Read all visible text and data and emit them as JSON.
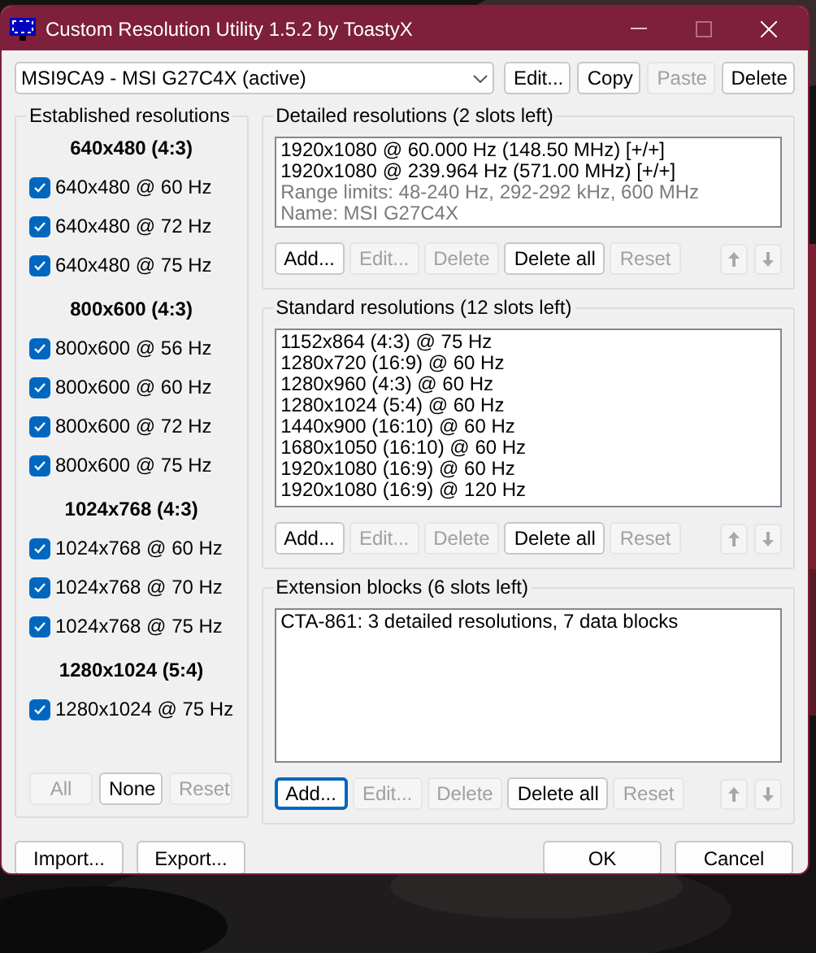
{
  "window": {
    "title": "Custom Resolution Utility 1.5.2 by ToastyX"
  },
  "device_select": {
    "value": "MSI9CA9 - MSI G27C4X (active)"
  },
  "top_buttons": [
    {
      "label": "Edit...",
      "disabled": false
    },
    {
      "label": "Copy",
      "disabled": false
    },
    {
      "label": "Paste",
      "disabled": true
    },
    {
      "label": "Delete",
      "disabled": false
    }
  ],
  "established": {
    "title": "Established resolutions",
    "groups": [
      {
        "heading": "640x480 (4:3)",
        "items": [
          {
            "label": "640x480 @ 60 Hz",
            "checked": true
          },
          {
            "label": "640x480 @ 72 Hz",
            "checked": true
          },
          {
            "label": "640x480 @ 75 Hz",
            "checked": true
          }
        ]
      },
      {
        "heading": "800x600 (4:3)",
        "items": [
          {
            "label": "800x600 @ 56 Hz",
            "checked": true
          },
          {
            "label": "800x600 @ 60 Hz",
            "checked": true
          },
          {
            "label": "800x600 @ 72 Hz",
            "checked": true
          },
          {
            "label": "800x600 @ 75 Hz",
            "checked": true
          }
        ]
      },
      {
        "heading": "1024x768 (4:3)",
        "items": [
          {
            "label": "1024x768 @ 60 Hz",
            "checked": true
          },
          {
            "label": "1024x768 @ 70 Hz",
            "checked": true
          },
          {
            "label": "1024x768 @ 75 Hz",
            "checked": true
          }
        ]
      },
      {
        "heading": "1280x1024 (5:4)",
        "items": [
          {
            "label": "1280x1024 @ 75 Hz",
            "checked": true
          }
        ]
      }
    ],
    "buttons": [
      {
        "label": "All",
        "disabled": true
      },
      {
        "label": "None",
        "disabled": false
      },
      {
        "label": "Reset",
        "disabled": true
      }
    ]
  },
  "sections": [
    {
      "title": "Detailed resolutions (2 slots left)",
      "entries": [
        {
          "text": "1920x1080 @ 60.000 Hz (148.50 MHz) [+/+]",
          "kind": "mode"
        },
        {
          "text": "1920x1080 @ 239.964 Hz (571.00 MHz) [+/+]",
          "kind": "mode"
        },
        {
          "text": "Range limits: 48-240 Hz, 292-292 kHz, 600 MHz",
          "kind": "info"
        },
        {
          "text": "Name: MSI G27C4X",
          "kind": "info"
        }
      ],
      "buttons": [
        {
          "label": "Add...",
          "disabled": false,
          "focused": false
        },
        {
          "label": "Edit...",
          "disabled": true,
          "focused": false
        },
        {
          "label": "Delete",
          "disabled": true,
          "focused": false
        },
        {
          "label": "Delete all",
          "disabled": false,
          "focused": false
        },
        {
          "label": "Reset",
          "disabled": true,
          "focused": false
        }
      ]
    },
    {
      "title": "Standard resolutions (12 slots left)",
      "entries": [
        {
          "text": "1152x864 (4:3) @ 75 Hz",
          "kind": "mode"
        },
        {
          "text": "1280x720 (16:9) @ 60 Hz",
          "kind": "mode"
        },
        {
          "text": "1280x960 (4:3) @ 60 Hz",
          "kind": "mode"
        },
        {
          "text": "1280x1024 (5:4) @ 60 Hz",
          "kind": "mode"
        },
        {
          "text": "1440x900 (16:10) @ 60 Hz",
          "kind": "mode"
        },
        {
          "text": "1680x1050 (16:10) @ 60 Hz",
          "kind": "mode"
        },
        {
          "text": "1920x1080 (16:9) @ 60 Hz",
          "kind": "mode"
        },
        {
          "text": "1920x1080 (16:9) @ 120 Hz",
          "kind": "mode"
        }
      ],
      "buttons": [
        {
          "label": "Add...",
          "disabled": false,
          "focused": false
        },
        {
          "label": "Edit...",
          "disabled": true,
          "focused": false
        },
        {
          "label": "Delete",
          "disabled": true,
          "focused": false
        },
        {
          "label": "Delete all",
          "disabled": false,
          "focused": false
        },
        {
          "label": "Reset",
          "disabled": true,
          "focused": false
        }
      ]
    },
    {
      "title": "Extension blocks (6 slots left)",
      "entries": [
        {
          "text": "CTA-861: 3 detailed resolutions, 7 data blocks",
          "kind": "mode"
        }
      ],
      "buttons": [
        {
          "label": "Add...",
          "disabled": false,
          "focused": true
        },
        {
          "label": "Edit...",
          "disabled": true,
          "focused": false
        },
        {
          "label": "Delete",
          "disabled": true,
          "focused": false
        },
        {
          "label": "Delete all",
          "disabled": false,
          "focused": false
        },
        {
          "label": "Reset",
          "disabled": true,
          "focused": false
        }
      ]
    }
  ],
  "bottom_left_buttons": [
    {
      "label": "Import..."
    },
    {
      "label": "Export..."
    }
  ],
  "bottom_right_buttons": [
    {
      "label": "OK"
    },
    {
      "label": "Cancel"
    }
  ]
}
